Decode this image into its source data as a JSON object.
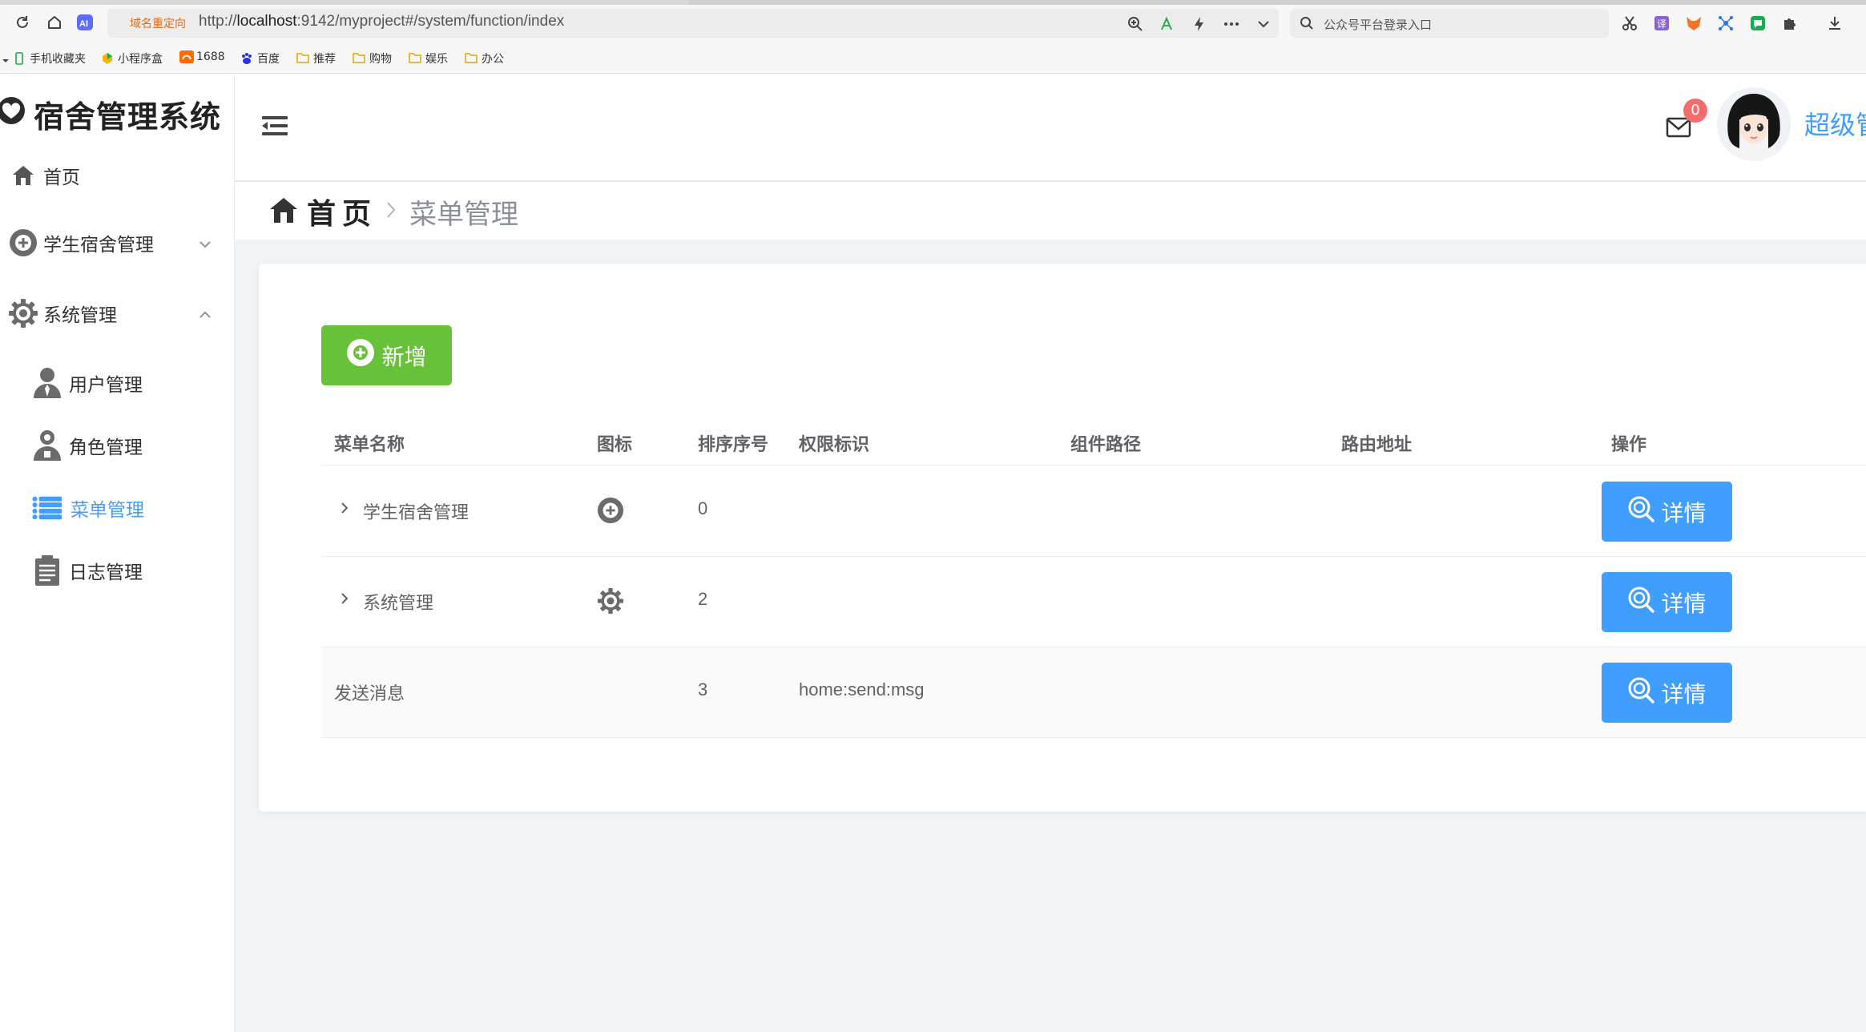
{
  "browser": {
    "url_tag": "域名重定向",
    "url_prefix": "http://",
    "url_host": "localhost",
    "url_rest": ":9142/myproject#/system/function/index",
    "search_placeholder": "公众号平台登录入口"
  },
  "bookmarks": [
    {
      "label": "手机收藏夹",
      "icon": "phone-icon"
    },
    {
      "label": "小程序盒",
      "icon": "app-icon"
    },
    {
      "label": "1688",
      "icon": "1688-icon"
    },
    {
      "label": "百度",
      "icon": "baidu-icon"
    },
    {
      "label": "推荐",
      "icon": "folder-icon"
    },
    {
      "label": "购物",
      "icon": "folder-icon"
    },
    {
      "label": "娱乐",
      "icon": "folder-icon"
    },
    {
      "label": "办公",
      "icon": "folder-icon"
    }
  ],
  "app": {
    "title": "宿舍管理系统",
    "accent": "#409eff",
    "success": "#67c23a"
  },
  "sidebar": {
    "items": [
      {
        "label": "首页",
        "icon": "home-icon"
      },
      {
        "label": "学生宿舍管理",
        "icon": "plus-circle-icon",
        "expanded": false
      },
      {
        "label": "系统管理",
        "icon": "gear-icon",
        "expanded": true
      },
      {
        "label": "用户管理",
        "icon": "user-icon"
      },
      {
        "label": "角色管理",
        "icon": "role-icon"
      },
      {
        "label": "菜单管理",
        "icon": "list-icon",
        "active": true
      },
      {
        "label": "日志管理",
        "icon": "log-icon"
      }
    ]
  },
  "header": {
    "badge_count": "0",
    "user_name": "超级管"
  },
  "breadcrumb": {
    "home": "首页",
    "current": "菜单管理"
  },
  "toolbar": {
    "add_label": "新增"
  },
  "table": {
    "columns": [
      "菜单名称",
      "图标",
      "排序序号",
      "权限标识",
      "组件路径",
      "路由地址",
      "操作"
    ],
    "rows": [
      {
        "name": "学生宿舍管理",
        "icon": "plus-circle-icon",
        "order": "0",
        "perm": "",
        "component": "",
        "route": "",
        "has_children": true,
        "action": "详情"
      },
      {
        "name": "系统管理",
        "icon": "gear-icon",
        "order": "2",
        "perm": "",
        "component": "",
        "route": "",
        "has_children": true,
        "action": "详情"
      },
      {
        "name": "发送消息",
        "icon": "",
        "order": "3",
        "perm": "home:send:msg",
        "component": "",
        "route": "",
        "has_children": false,
        "action": "详情"
      }
    ]
  }
}
